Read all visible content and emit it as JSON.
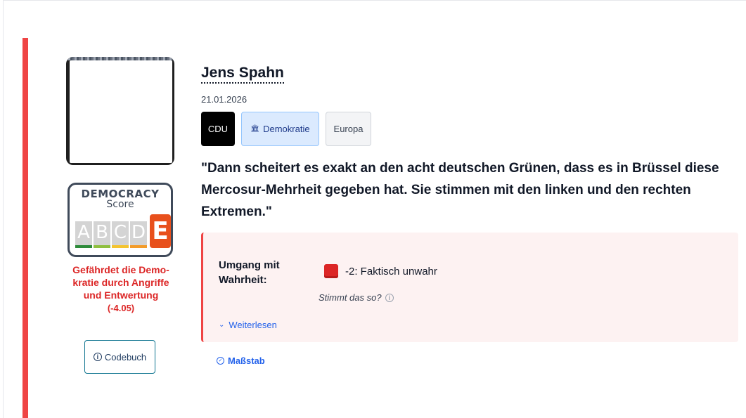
{
  "politician": {
    "name": "Jens Spahn",
    "date": "21.01.2026"
  },
  "tags": {
    "party": "CDU",
    "topic": "Demokratie",
    "topic_icon": "bank-icon",
    "region": "Europa"
  },
  "quote": "\"Dann scheitert es exakt an den acht deutschen Grünen, dass es in Brüssel diese Mercosur-Mehrheit gegeben hat. Sie stimmen mit den linken und den rechten Extremen.\"",
  "score": {
    "title": "DEMOCRACY",
    "subtitle": "Score",
    "grades": [
      "A",
      "B",
      "C",
      "D"
    ],
    "grade_colors": [
      "#2e8b3a",
      "#8fbf3f",
      "#f4c430",
      "#f39c2a"
    ],
    "active_grade": "E",
    "active_color": "#e8501c",
    "verdict": "Gefährdet die Demo-kratie durch Angriffe und Entwertung",
    "value": "(-4.05)"
  },
  "codebook": {
    "label": "Codebuch",
    "icon": "info-icon"
  },
  "assessment": {
    "label": "Umgang mit Wahrheit:",
    "value": "-2: Faktisch unwahr",
    "question": "Stimmt das so?",
    "read_more": "Weiterlesen"
  },
  "scale_link": "Maßstab",
  "colors": {
    "accent": "#ef4444",
    "link": "#2563eb"
  }
}
